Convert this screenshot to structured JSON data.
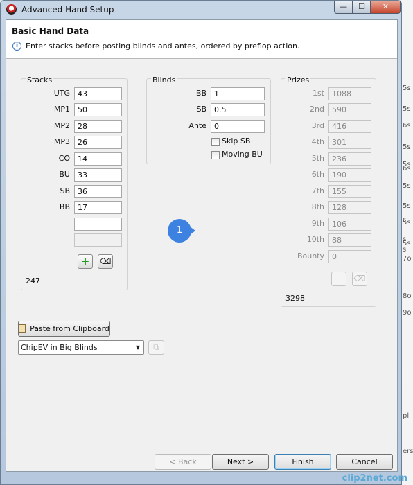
{
  "window": {
    "title": "Advanced Hand Setup",
    "min_glyph": "—",
    "max_glyph": "☐",
    "close_glyph": "✕"
  },
  "header": {
    "title": "Basic Hand Data",
    "message": "Enter stacks before posting blinds and antes, ordered by preflop action."
  },
  "stacks": {
    "title": "Stacks",
    "rows": [
      {
        "label": "UTG",
        "value": "43"
      },
      {
        "label": "MP1",
        "value": "50"
      },
      {
        "label": "MP2",
        "value": "28"
      },
      {
        "label": "MP3",
        "value": "26"
      },
      {
        "label": "CO",
        "value": "14"
      },
      {
        "label": "BU",
        "value": "33"
      },
      {
        "label": "SB",
        "value": "36"
      },
      {
        "label": "BB",
        "value": "17"
      }
    ],
    "new_value": "",
    "total": "247"
  },
  "blinds": {
    "title": "Blinds",
    "bb": {
      "label": "BB",
      "value": "1"
    },
    "sb": {
      "label": "SB",
      "value": "0.5"
    },
    "ante": {
      "label": "Ante",
      "value": "0"
    },
    "skip_sb": {
      "label": "Skip SB",
      "checked": false
    },
    "moving_bu": {
      "label": "Moving BU",
      "checked": false
    }
  },
  "prizes": {
    "title": "Prizes",
    "rows": [
      {
        "label": "1st",
        "value": "1088"
      },
      {
        "label": "2nd",
        "value": "590"
      },
      {
        "label": "3rd",
        "value": "416"
      },
      {
        "label": "4th",
        "value": "301"
      },
      {
        "label": "5th",
        "value": "236"
      },
      {
        "label": "6th",
        "value": "190"
      },
      {
        "label": "7th",
        "value": "155"
      },
      {
        "label": "8th",
        "value": "128"
      },
      {
        "label": "9th",
        "value": "106"
      },
      {
        "label": "10th",
        "value": "88"
      },
      {
        "label": "Bounty",
        "value": "0"
      }
    ],
    "total": "3298"
  },
  "badge": "1",
  "paste_button": "Paste from Clipboard",
  "model_select": {
    "value": "ChipEV in Big Blinds"
  },
  "footer": {
    "back": "< Back",
    "next": "Next >",
    "finish": "Finish",
    "cancel": "Cancel"
  },
  "background_fragments": [
    "5s",
    "5s",
    "6s",
    "5s",
    "5s",
    "6s",
    "5s",
    "5s",
    "s",
    "5s",
    "s",
    "5s",
    "s",
    "7o",
    "8o",
    "9o",
    "pl",
    "ersi"
  ],
  "watermark": "clip2net.com"
}
